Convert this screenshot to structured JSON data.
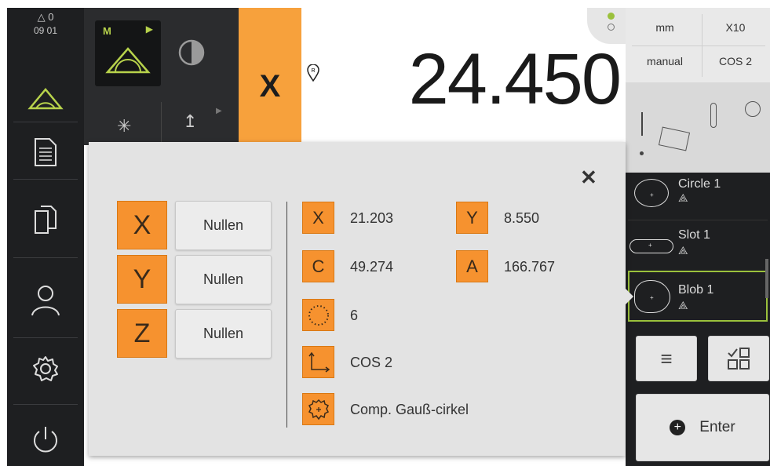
{
  "status": {
    "warnings": "0",
    "time": "09 01"
  },
  "main": {
    "axis_label": "X",
    "value": "24.450",
    "ref_marker": "R"
  },
  "infobox": {
    "unit": "mm",
    "zoom": "X10",
    "mode": "manual",
    "coord_system": "COS 2"
  },
  "features": [
    {
      "label": "Circle 1"
    },
    {
      "label": "Slot 1"
    },
    {
      "label": "Blob 1"
    }
  ],
  "enter_label": "Enter",
  "dialog": {
    "axes": [
      {
        "label": "X",
        "button": "Nullen"
      },
      {
        "label": "Y",
        "button": "Nullen"
      },
      {
        "label": "Z",
        "button": "Nullen"
      }
    ],
    "params": {
      "x_label": "X",
      "x_value": "21.203",
      "y_label": "Y",
      "y_value": "8.550",
      "c_label": "C",
      "c_value": "49.274",
      "a_label": "A",
      "a_value": "166.767",
      "points_value": "6",
      "cos_value": "COS 2",
      "fit_value": "Comp. Gauß-cirkel"
    }
  },
  "colors": {
    "accent": "#f6922f",
    "nav_bg": "#1e1f21",
    "dialog_bg": "#e3e3e3",
    "selected": "#9bc13c"
  }
}
